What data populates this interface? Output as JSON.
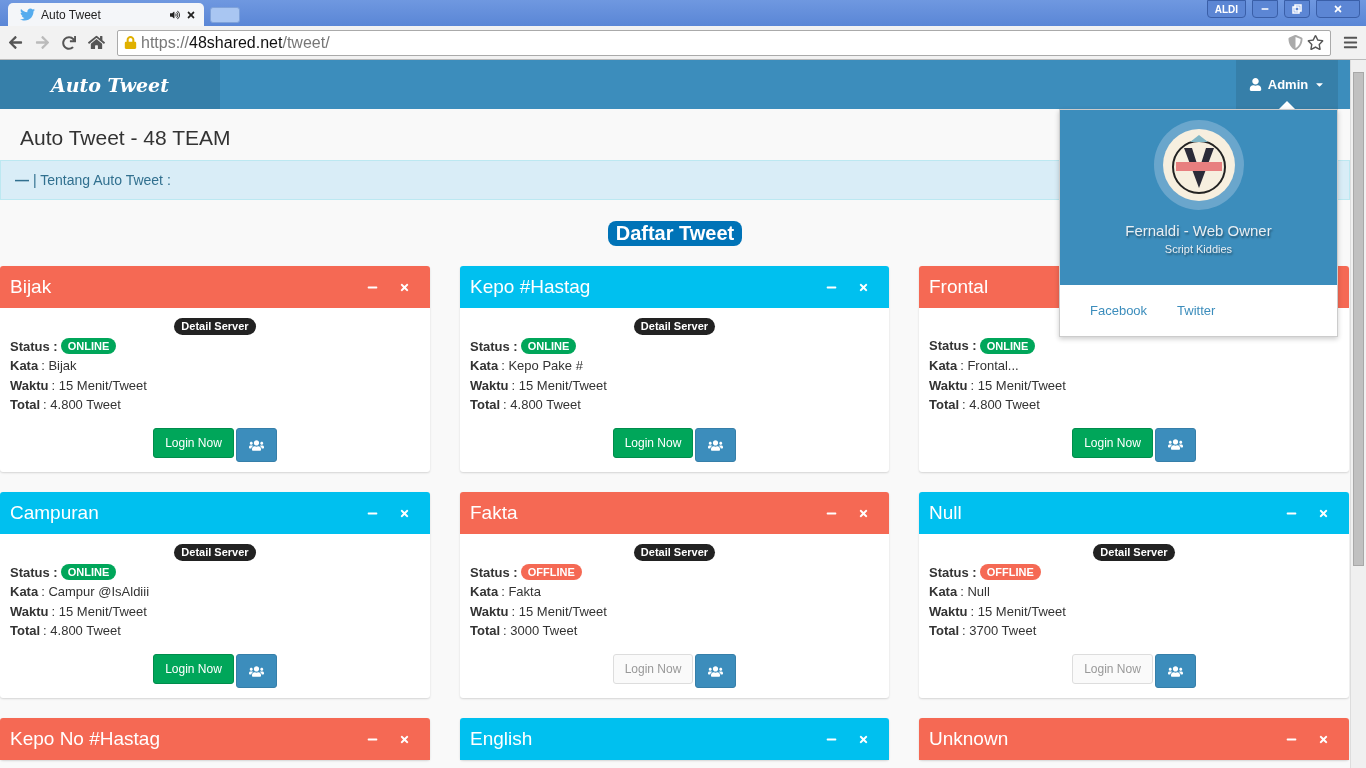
{
  "browser": {
    "tab_title": "Auto Tweet",
    "url_scheme": "https://",
    "url_host": "48shared.net",
    "url_path": "/tweet/",
    "profile": "ALDI"
  },
  "navbar": {
    "brand": "Auto Tweet",
    "user": "Admin"
  },
  "page_title": "Auto Tweet - 48 TEAM",
  "info_bar": {
    "toggle": "—",
    "label": "| Tentang Auto Tweet :"
  },
  "section_title": "Daftar Tweet",
  "cards": [
    {
      "title": "Bijak",
      "color": "#f56954",
      "detail": "Detail Server",
      "status_label": "Status :",
      "status": "ONLINE",
      "online": true,
      "rows": [
        {
          "label": "Kata",
          "value": ": Bijak"
        },
        {
          "label": "Waktu",
          "value": ": 15 Menit/Tweet"
        },
        {
          "label": "Total",
          "value": ": 4.800 Tweet"
        }
      ],
      "login": "Login Now"
    },
    {
      "title": "Kepo #Hastag",
      "color": "#00c0ef",
      "detail": "Detail Server",
      "status_label": "Status :",
      "status": "ONLINE",
      "online": true,
      "rows": [
        {
          "label": "Kata",
          "value": ": Kepo Pake #"
        },
        {
          "label": "Waktu",
          "value": ": 15 Menit/Tweet"
        },
        {
          "label": "Total",
          "value": ": 4.800 Tweet"
        }
      ],
      "login": "Login Now"
    },
    {
      "title": "Frontal",
      "color": "#f56954",
      "tools_shown": false,
      "status_label": "Status :",
      "status": "ONLINE",
      "online": true,
      "rows": [
        {
          "label": "Kata",
          "value": ": Frontal..."
        },
        {
          "label": "Waktu",
          "value": ": 15 Menit/Tweet"
        },
        {
          "label": "Total",
          "value": ": 4.800 Tweet"
        }
      ],
      "login": "Login Now"
    },
    {
      "title": "Campuran",
      "color": "#00c0ef",
      "detail": "Detail Server",
      "status_label": "Status :",
      "status": "ONLINE",
      "online": true,
      "rows": [
        {
          "label": "Kata",
          "value": ": Campur @IsAldiii"
        },
        {
          "label": "Waktu",
          "value": ": 15 Menit/Tweet"
        },
        {
          "label": "Total",
          "value": ": 4.800 Tweet"
        }
      ],
      "login": "Login Now"
    },
    {
      "title": "Fakta",
      "color": "#f56954",
      "detail": "Detail Server",
      "status_label": "Status :",
      "status": "OFFLINE",
      "online": false,
      "rows": [
        {
          "label": "Kata",
          "value": ": Fakta"
        },
        {
          "label": "Waktu",
          "value": ": 15 Menit/Tweet"
        },
        {
          "label": "Total",
          "value": ": 3000 Tweet"
        }
      ],
      "login": "Login Now"
    },
    {
      "title": "Null",
      "color": "#00c0ef",
      "detail": "Detail Server",
      "status_label": "Status :",
      "status": "OFFLINE",
      "online": false,
      "rows": [
        {
          "label": "Kata",
          "value": ": Null"
        },
        {
          "label": "Waktu",
          "value": ": 15 Menit/Tweet"
        },
        {
          "label": "Total",
          "value": ": 3700 Tweet"
        }
      ],
      "login": "Login Now"
    },
    {
      "title": "Kepo No #Hastag",
      "color": "#f56954"
    },
    {
      "title": "English",
      "color": "#00c0ef"
    },
    {
      "title": "Unknown",
      "color": "#f56954"
    }
  ],
  "user_menu": {
    "name": "Fernaldi - Web Owner",
    "role": "Script Kiddies",
    "links": [
      "Facebook",
      "Twitter"
    ]
  }
}
